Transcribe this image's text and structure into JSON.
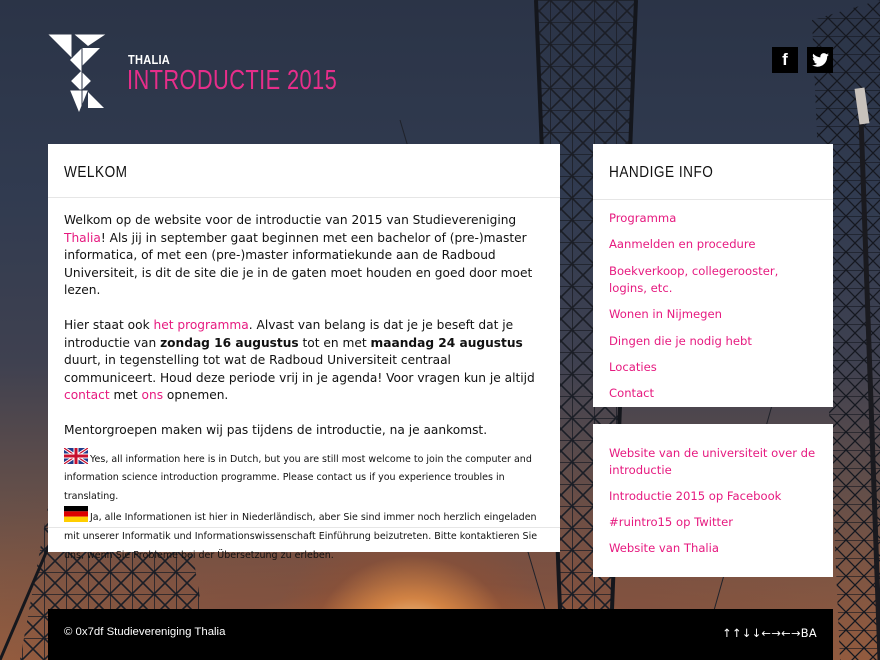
{
  "header": {
    "brand_small": "THALIA",
    "brand_big": "INTRODUCTIE 2015",
    "social": [
      {
        "icon": "facebook-icon",
        "glyph": "f"
      },
      {
        "icon": "twitter-icon"
      }
    ]
  },
  "welcome": {
    "title": "WELKOM",
    "p1": {
      "before": "Welkom op de website voor de introductie van 2015 van Studievereniging ",
      "link": "Thalia",
      "after": "! Als jij in september gaat beginnen met een bachelor of (pre-)master informatica, of met een (pre-)master informatiekunde aan de Radboud Universiteit, is dit de site die je in de gaten moet houden en goed door moet lezen."
    },
    "p2": {
      "t1": "Hier staat ook ",
      "link_programma": "het programma",
      "t2": ". Alvast van belang is dat je je beseft dat je introductie van ",
      "bold1": "zondag 16 augustus",
      "t3": " tot en met ",
      "bold2": "maandag 24 augustus",
      "t4": " duurt, in tegenstelling tot wat de Radboud Universiteit centraal communiceert. Houd deze periode vrij in je agenda! Voor vragen kun je altijd ",
      "link_contact": "contact",
      "t5": " met ",
      "link_ons": "ons",
      "t6": " opnemen."
    },
    "p3": "Mentorgroepen maken wij pas tijdens de introductie, na je aankomst.",
    "note_en": "Yes, all information here is in Dutch, but you are still most welcome to join the computer and information science introduction programme. Please contact us if you experience troubles in translating.",
    "note_de": "Ja, alle Informationen ist hier in Niederländisch, aber Sie sind immer noch herzlich eingeladen mit unserer Informatik und Informationswissenschaft Einführung beizutreten. Bitte kontaktieren Sie uns, wenn Sie Probleme bei der Übersetzung zu erleben."
  },
  "handige_info": {
    "title": "HANDIGE INFO",
    "links": [
      "Programma",
      "Aanmelden en procedure",
      "Boekverkoop, collegerooster, logins, etc.",
      "Wonen in Nijmegen",
      "Dingen die je nodig hebt",
      "Locaties",
      "Contact"
    ]
  },
  "external_links": [
    "Website van de universiteit over de introductie",
    "Introductie 2015 op Facebook",
    "#ruintro15 op Twitter",
    "Website van Thalia"
  ],
  "footer": {
    "copyright": "© 0x7df Studievereniging Thalia",
    "konami": "↑↑↓↓←→←→BA"
  },
  "colors": {
    "accent": "#e6197f",
    "card": "#ffffff",
    "footer": "#000000"
  }
}
